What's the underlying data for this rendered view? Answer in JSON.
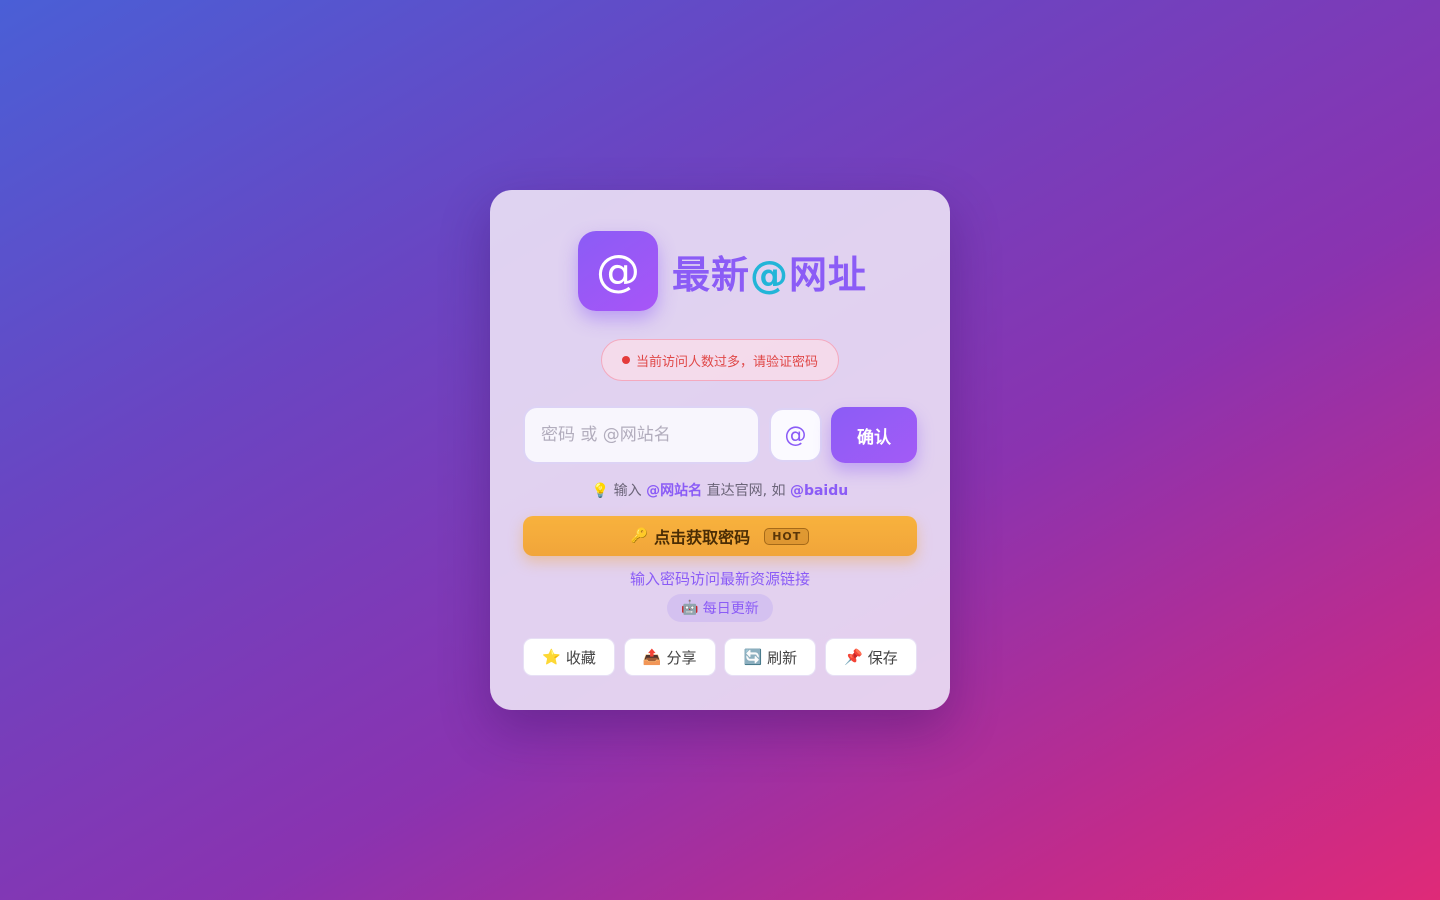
{
  "header": {
    "logo_symbol": "@",
    "title_part1": "最新",
    "title_at": "@",
    "title_part2": "网址"
  },
  "alert": {
    "text": "当前访问人数过多，请验证密码"
  },
  "form": {
    "placeholder": "密码 或 @网站名",
    "at_label": "@",
    "confirm_label": "确认"
  },
  "tip": {
    "icon": "💡",
    "prefix": "输入",
    "keyword": "@网站名",
    "middle": "直达官网, 如",
    "example": "@baidu"
  },
  "get_password": {
    "icon": "🔑",
    "label": "点击获取密码",
    "badge": "HOT"
  },
  "subtitle": "输入密码访问最新资源链接",
  "daily_badge": {
    "icon": "🤖",
    "label": "每日更新"
  },
  "actions": [
    {
      "icon": "⭐",
      "label": "收藏"
    },
    {
      "icon": "📤",
      "label": "分享"
    },
    {
      "icon": "🔄",
      "label": "刷新"
    },
    {
      "icon": "📌",
      "label": "保存"
    }
  ],
  "colors": {
    "accent": "#8b5cf6",
    "at_accent": "#22b5d8",
    "alert": "#e04848",
    "cta": "#f1a53a"
  }
}
